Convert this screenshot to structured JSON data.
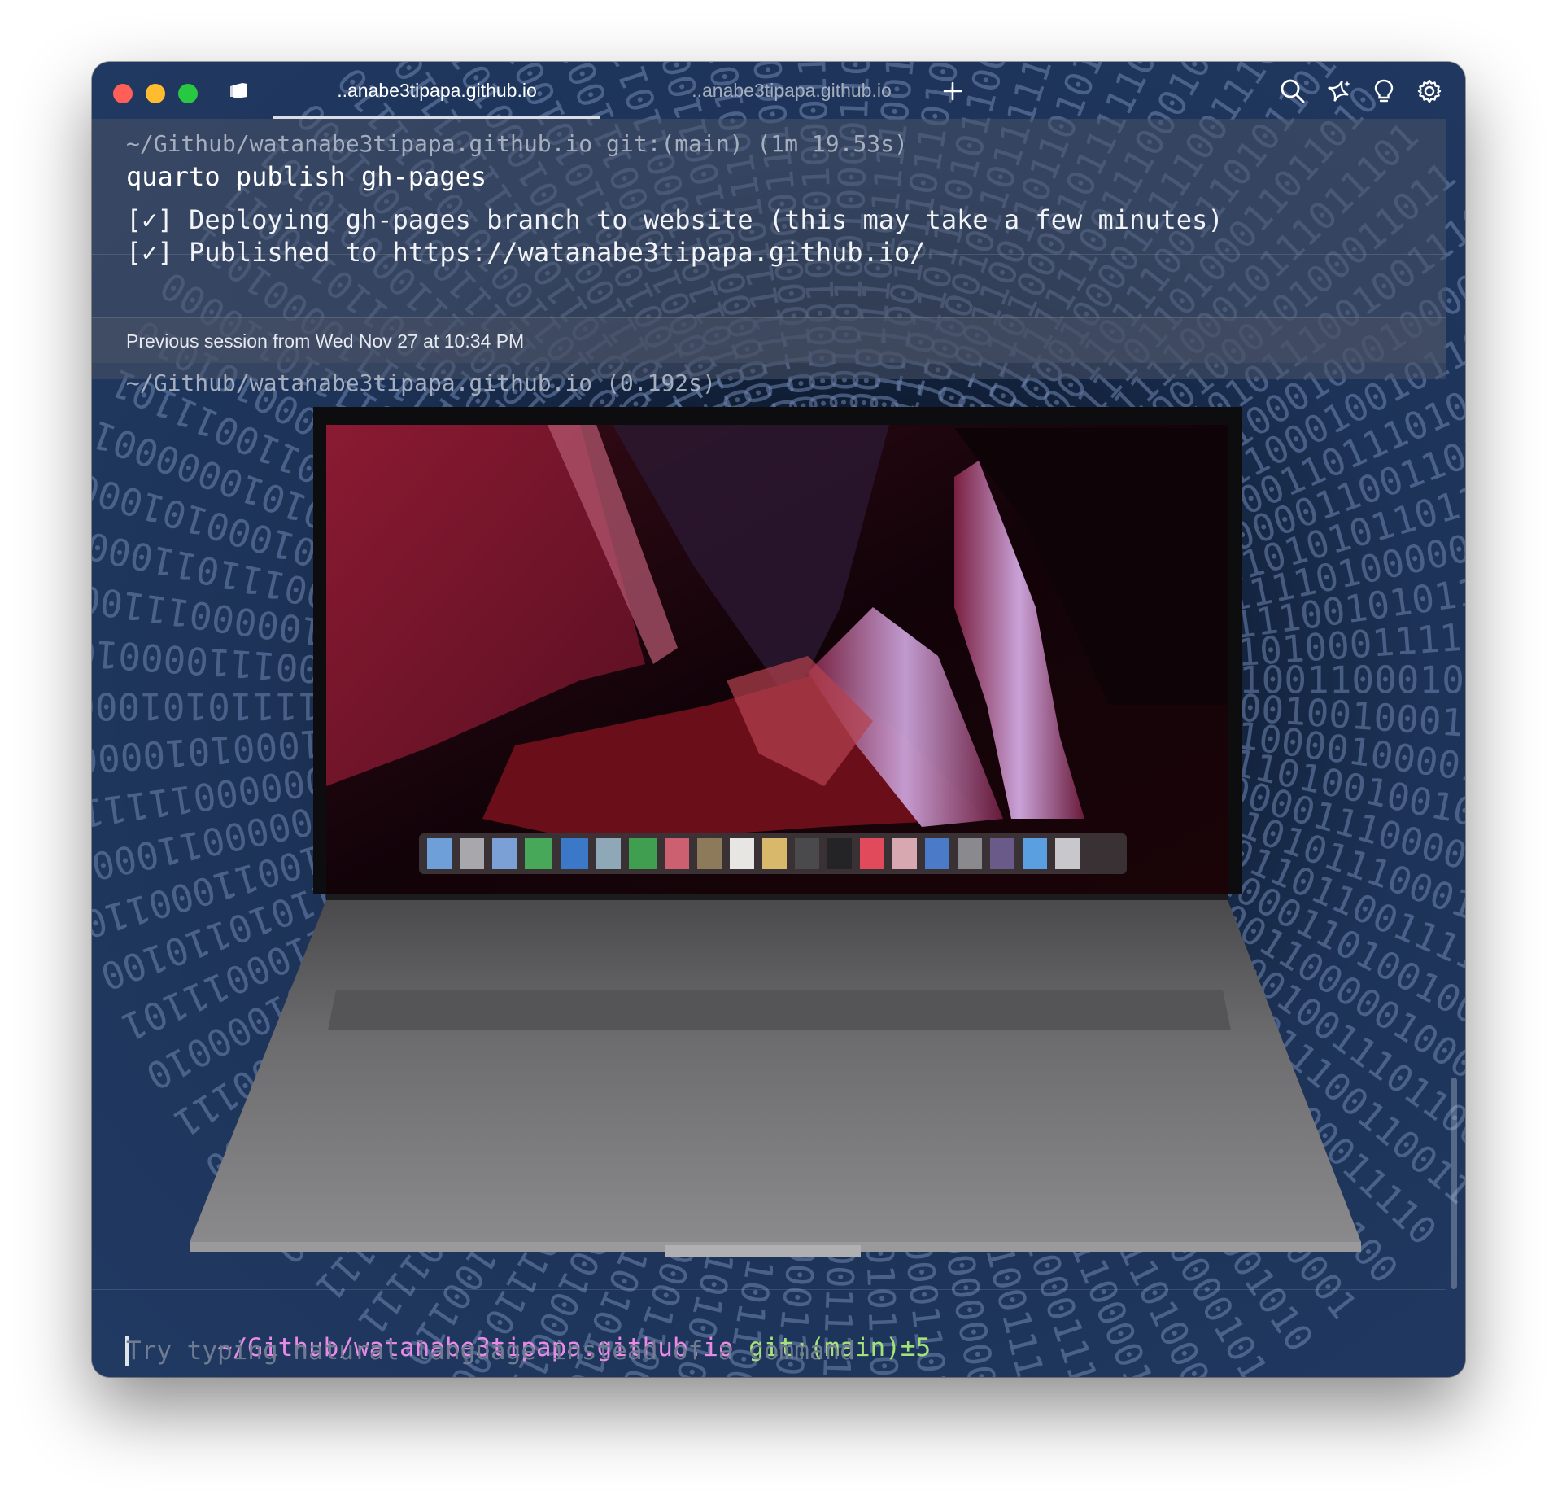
{
  "window": {
    "accent_color": "#d9dde6",
    "traffic_lights": {
      "close_color": "#ff5f57",
      "minimize_color": "#febc2e",
      "maximize_color": "#28c840"
    }
  },
  "tabs": [
    {
      "label": "..anabe3tipapa.github.io",
      "active": true
    },
    {
      "label": "..anabe3tipapa.github.io",
      "active": false
    }
  ],
  "toolbar": {
    "new_tab_icon": "plus-icon",
    "icons": [
      "search-icon",
      "ai-sparkle-icon",
      "lightbulb-icon",
      "gear-icon"
    ]
  },
  "blocks": [
    {
      "prompt": "~/Github/watanabe3tipapa.github.io git:(main) (1m 19.53s)",
      "command": "quarto publish gh-pages",
      "output": [
        "[✓] Deploying gh-pages branch to website (this may take a few minutes)",
        "[✓] Published to https://watanabe3tipapa.github.io/"
      ]
    }
  ],
  "session_banner": "Previous session from Wed Nov 27 at 10:34 PM",
  "image_block": {
    "prompt": "~/Github/watanabe3tipapa.github.io (0.192s)",
    "image_description_icon": "laptop-pixel-art-image"
  },
  "input": {
    "path": "~/Github/watanabe3tipapa.github.io",
    "git": "git:(main)±5",
    "path_color": "#e98ae6",
    "git_color": "#a4e37a",
    "placeholder": "Try typing natural language instead of a command"
  }
}
